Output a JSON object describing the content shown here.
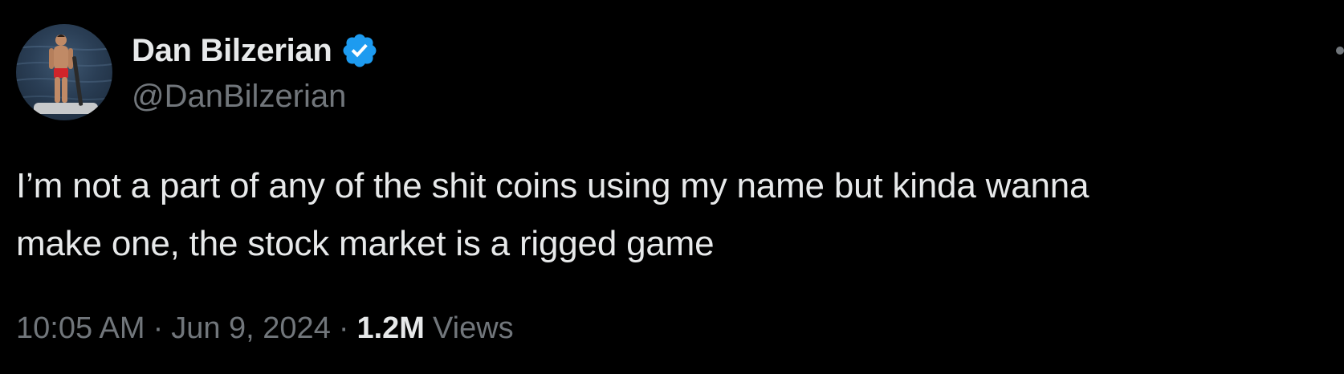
{
  "author": {
    "display_name": "Dan Bilzerian",
    "handle": "@DanBilzerian",
    "verified_icon": "verified-badge-icon",
    "verified_color": "#1d9bf0"
  },
  "tweet": {
    "text": "I’m not a part of any of the shit coins using my name but kinda wanna\nmake one, the stock market is a rigged game",
    "time": "10:05 AM",
    "date": "Jun 9, 2024",
    "separator": "·",
    "views_count": "1.2M",
    "views_label": "Views"
  },
  "more_icon": "more-options-icon",
  "colors": {
    "background": "#000000",
    "primary_text": "#e7e9ea",
    "secondary_text": "#71767b"
  }
}
